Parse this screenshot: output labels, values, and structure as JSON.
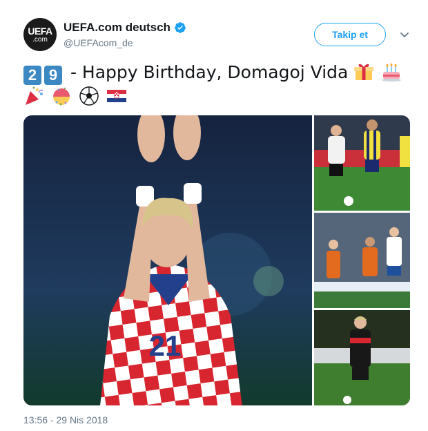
{
  "tweet": {
    "display_name": "UEFA.com deutsch",
    "handle": "@UEFAcom_de",
    "avatar_line1": "UEFA",
    "avatar_line2": ".com",
    "follow_label": "Takip et",
    "number_digits": [
      "2",
      "9"
    ],
    "text": " - Happy Birthday, Domagoj Vida",
    "emojis_line1": [
      "gift-emoji",
      "birthday-cake-emoji"
    ],
    "emojis_line2": [
      "party-popper-emoji",
      "confetti-ball-emoji",
      "soccer-ball-emoji",
      "croatia-flag-emoji"
    ],
    "jersey_number": "21",
    "timestamp": "13:56 - 29 Nis 2018"
  },
  "colors": {
    "brand_blue": "#1da1f2",
    "keycap_blue": "#3b88c3",
    "text_dark": "#14171a",
    "text_gray": "#657786"
  },
  "icons": [
    "verified-badge-icon",
    "chevron-down-icon"
  ]
}
